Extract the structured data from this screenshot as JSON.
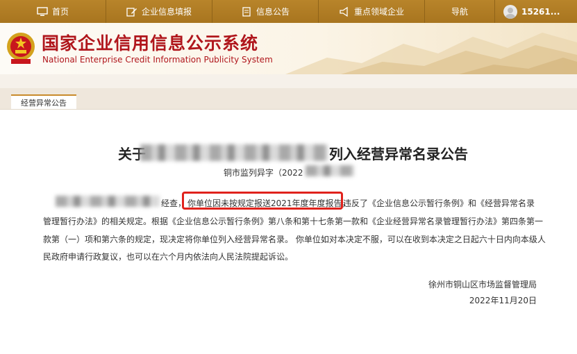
{
  "nav": {
    "home": "首页",
    "fill": "企业信息填报",
    "notice": "信息公告",
    "key": "重点领域企业",
    "guide": "导航",
    "user": "15261..."
  },
  "header": {
    "title_cn": "国家企业信用信息公示系统",
    "title_en": "National Enterprise Credit Information Publicity System"
  },
  "tab": {
    "label": "经营异常公告"
  },
  "doc": {
    "title_prefix": "关于",
    "title_suffix": "列入经营异常名录公告",
    "doc_no_prefix": "铜市监列异字（2022",
    "line1_after_blur": "经查，",
    "highlight": "你单位因未按规定报送2021年度年度报告，",
    "line1_tail": "违反了《企业信息公示暂行条例》和《经营异常名录",
    "line2": "管理暂行办法》的相关规定。根据《企业信息公示暂行条例》第八条和第十七条第一款和《企业经营异常名录管理暂行办法》第四条第一",
    "line3": "款第（一）项和第六条的规定，现决定将你单位列入经营异常名录。 你单位如对本决定不服，可以在收到本决定之日起六十日内向本级人",
    "line4": "民政府申请行政复议，也可以在六个月内依法向人民法院提起诉讼。",
    "issuer": "徐州市铜山区市场监督管理局",
    "date": "2022年11月20日"
  }
}
